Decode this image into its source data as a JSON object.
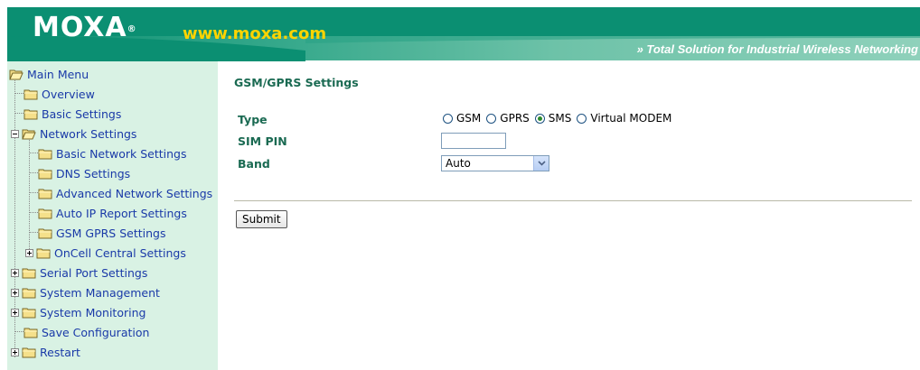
{
  "header": {
    "logo": "MOXA",
    "logo_mark": "®",
    "url": "www.moxa.com",
    "tagline": "» Total Solution for Industrial Wireless Networking"
  },
  "menu": {
    "items": [
      {
        "label": "Main Menu"
      },
      {
        "label": "Overview"
      },
      {
        "label": "Basic Settings"
      },
      {
        "label": "Network Settings"
      },
      {
        "label": "Basic Network Settings"
      },
      {
        "label": "DNS Settings"
      },
      {
        "label": "Advanced Network Settings"
      },
      {
        "label": "Auto IP Report Settings"
      },
      {
        "label": "GSM GPRS Settings"
      },
      {
        "label": "OnCell Central Settings"
      },
      {
        "label": "Serial Port Settings"
      },
      {
        "label": "System Management"
      },
      {
        "label": "System Monitoring"
      },
      {
        "label": "Save Configuration"
      },
      {
        "label": "Restart"
      }
    ]
  },
  "main": {
    "title": "GSM/GPRS Settings",
    "type_label": "Type",
    "type_options": [
      "GSM",
      "GPRS",
      "SMS",
      "Virtual MODEM"
    ],
    "type_selected": "SMS",
    "sim_pin_label": "SIM PIN",
    "sim_pin_value": "",
    "band_label": "Band",
    "band_value": "Auto",
    "submit_label": "Submit"
  },
  "colors": {
    "header_green": "#0b8f72",
    "sidebar_bg": "#d9f2e4",
    "menu_text": "#1a3aa8",
    "label_text": "#1a6a52",
    "logo_url": "#ffd400"
  }
}
